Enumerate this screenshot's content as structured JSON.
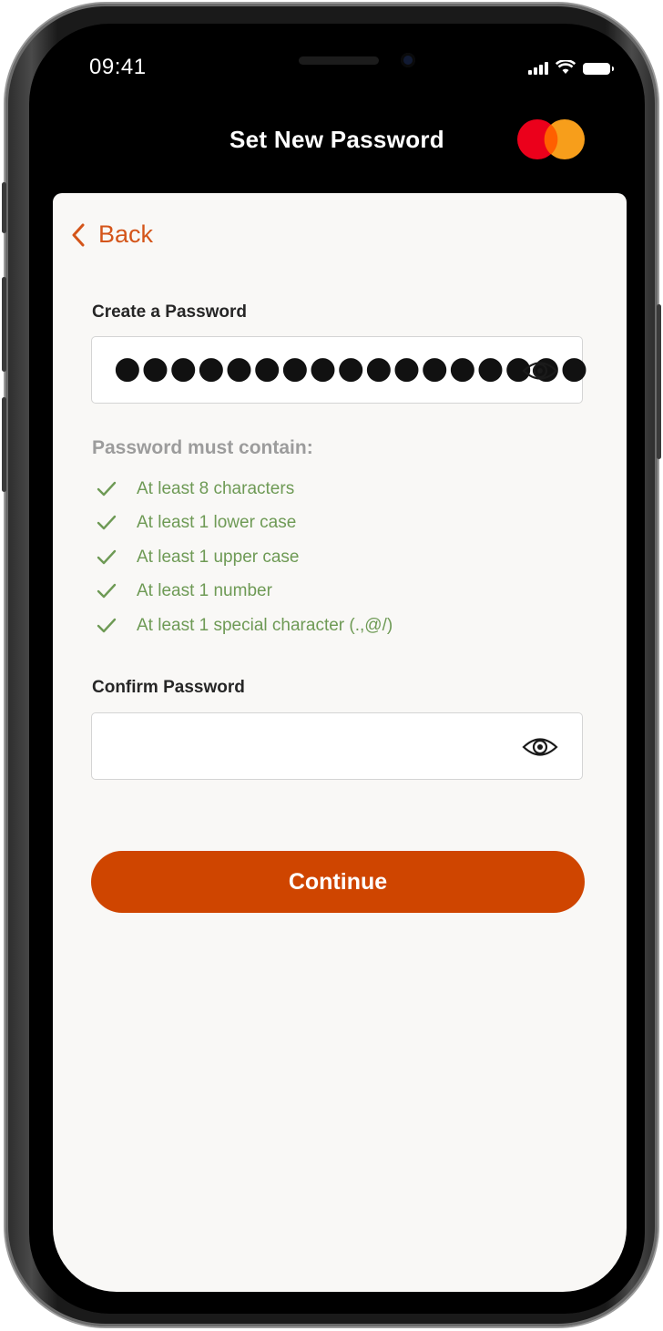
{
  "status_bar": {
    "time": "09:41"
  },
  "header": {
    "title": "Set New Password",
    "logo": "mastercard-logo",
    "logo_colors": [
      "#eb001b",
      "#f79e1b",
      "#ff5f00"
    ]
  },
  "nav": {
    "back_label": "Back"
  },
  "create_password": {
    "label": "Create a Password",
    "value": "●●●●●●●●●●●●●●●●●",
    "toggle_icon": "eye-icon"
  },
  "requirements": {
    "title": "Password must contain:",
    "items": [
      "At least 8 characters",
      "At least 1 lower case",
      "At least 1 upper case",
      "At least 1 number",
      "At least 1 special character (.,@/)"
    ],
    "met_color": "#6e9a55"
  },
  "confirm_password": {
    "label": "Confirm Password",
    "value": "",
    "toggle_icon": "eye-icon"
  },
  "actions": {
    "continue_label": "Continue"
  },
  "colors": {
    "accent": "#cf4500",
    "link": "#d4551a",
    "background": "#f9f8f6"
  }
}
